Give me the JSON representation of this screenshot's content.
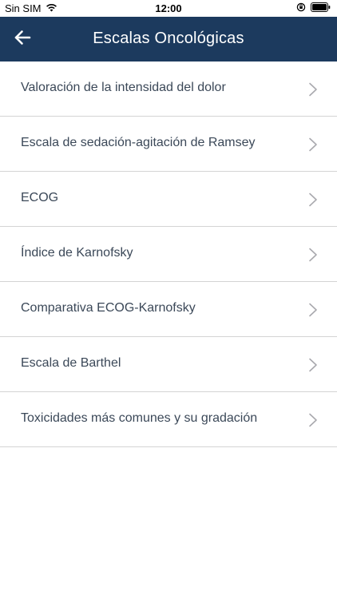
{
  "status_bar": {
    "carrier": "Sin SIM",
    "time": "12:00",
    "icons": [
      "wifi-icon",
      "rotation-lock-icon",
      "battery-icon"
    ]
  },
  "nav": {
    "title": "Escalas Oncológicas",
    "back_icon": "back-arrow-icon",
    "background_color": "#1c3a5e"
  },
  "list": {
    "items": [
      {
        "label": "Valoración de la intensidad del dolor"
      },
      {
        "label": "Escala de sedación-agitación de Ramsey"
      },
      {
        "label": "ECOG"
      },
      {
        "label": "Índice de Karnofsky"
      },
      {
        "label": "Comparativa ECOG-Karnofsky"
      },
      {
        "label": "Escala de Barthel"
      },
      {
        "label": "Toxicidades más comunes y su gradación"
      }
    ],
    "chevron_icon": "chevron-right-icon"
  }
}
